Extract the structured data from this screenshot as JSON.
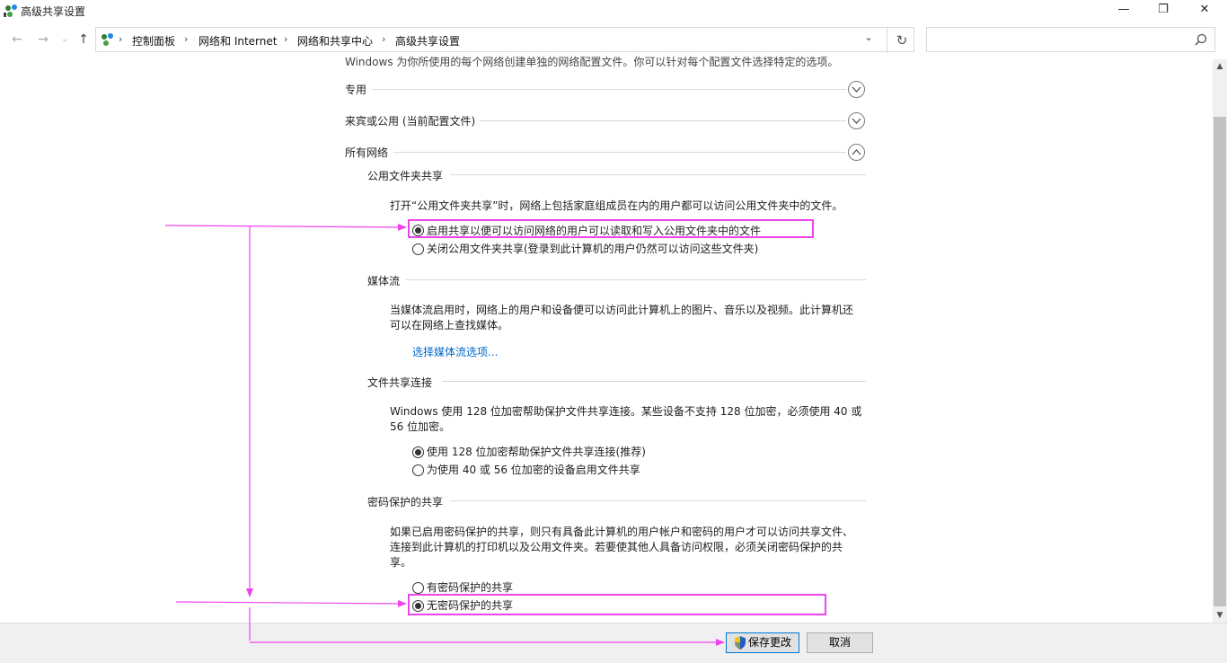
{
  "window": {
    "title": "高级共享设置",
    "minimize": "—",
    "maximize": "❐",
    "close": "✕"
  },
  "nav": {
    "breadcrumbs": [
      "控制面板",
      "网络和 Internet",
      "网络和共享中心",
      "高级共享设置"
    ],
    "search_placeholder": ""
  },
  "intro_text": "Windows 为你所使用的每个网络创建单独的网络配置文件。你可以针对每个配置文件选择特定的选项。",
  "profiles": {
    "private": "专用",
    "guest_public": "来宾或公用 (当前配置文件)",
    "all_networks": "所有网络"
  },
  "public_folder": {
    "heading": "公用文件夹共享",
    "description": "打开“公用文件夹共享”时，网络上包括家庭组成员在内的用户都可以访问公用文件夹中的文件。",
    "option_on": "启用共享以便可以访问网络的用户可以读取和写入公用文件夹中的文件",
    "option_off": "关闭公用文件夹共享(登录到此计算机的用户仍然可以访问这些文件夹)"
  },
  "media": {
    "heading": "媒体流",
    "description_line1": "当媒体流启用时，网络上的用户和设备便可以访问此计算机上的图片、音乐以及视频。此计算机还",
    "description_line2": "可以在网络上查找媒体。",
    "link": "选择媒体流选项..."
  },
  "file_sharing": {
    "heading": "文件共享连接",
    "description_line1": "Windows 使用 128 位加密帮助保护文件共享连接。某些设备不支持 128 位加密，必须使用 40 或",
    "description_line2": "56 位加密。",
    "option_128": "使用 128 位加密帮助保护文件共享连接(推荐)",
    "option_40_56": "为使用 40 或 56 位加密的设备启用文件共享"
  },
  "password": {
    "heading": "密码保护的共享",
    "description_line1": "如果已启用密码保护的共享，则只有具备此计算机的用户帐户和密码的用户才可以访问共享文件、",
    "description_line2": "连接到此计算机的打印机以及公用文件夹。若要使其他人具备访问权限，必须关闭密码保护的共",
    "description_line3": "享。",
    "option_on": "有密码保护的共享",
    "option_off": "无密码保护的共享"
  },
  "footer": {
    "save": "保存更改",
    "cancel": "取消"
  },
  "colors": {
    "annotation": "#ee44ee",
    "link": "#0066cc"
  }
}
